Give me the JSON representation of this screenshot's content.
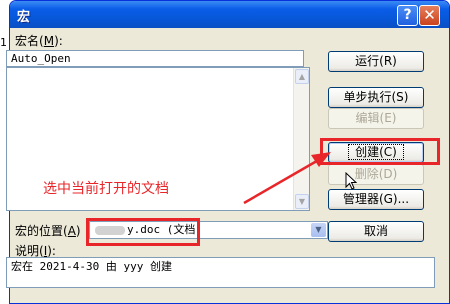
{
  "edge_digit": "1",
  "dialog": {
    "title": "宏",
    "help_glyph": "?",
    "close_glyph": "✕"
  },
  "macro_name": {
    "label_text": "宏名",
    "label_hotkey": "M",
    "value": "Auto_Open"
  },
  "buttons": {
    "run": "运行(R)",
    "step_into": "单步执行(S)",
    "edit": "编辑(E)",
    "create": "创建(C)",
    "delete": "删除(D)",
    "organizer": "管理器(G)...",
    "cancel": "取消"
  },
  "macros_in": {
    "label_text": "宏的位置",
    "label_hotkey": "A",
    "value": "y.doc (文档)"
  },
  "description": {
    "label_text": "说明",
    "label_hotkey": "I",
    "value": "宏在 2021-4-30 由 yyy 创建"
  },
  "annotation": {
    "text": "选中当前打开的文档",
    "color": "#e8262a"
  },
  "icons": {
    "scroll_up": "scroll-up-arrow-icon",
    "scroll_down": "scroll-down-arrow-icon",
    "dropdown": "chevron-down-icon",
    "cursor": "mouse-pointer-icon"
  }
}
